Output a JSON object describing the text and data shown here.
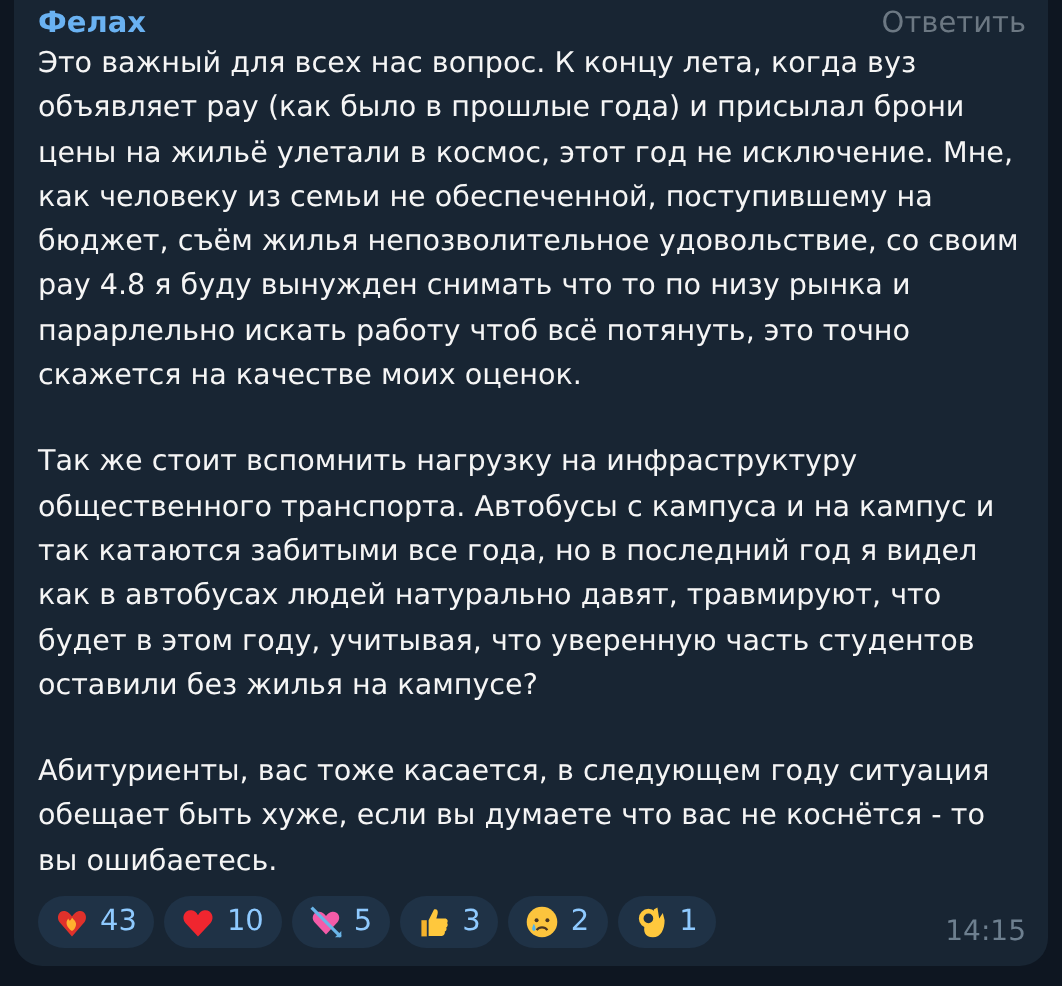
{
  "message": {
    "author": "Фелах",
    "reply_label": "Ответить",
    "paragraphs": [
      "Это важный для всех нас вопрос. К концу лета, когда вуз объявляет pay (как было в прошлые года) и присылал брони цены на жильё улетали в космос, этот год не исключение. Мне, как человеку из семьи не обеспеченной, поступившему на бюджет, съём жилья непозволительное удовольствие, со своим pay 4.8 я буду вынужден снимать что то по низу рынка и парарлельно искать работу чтоб всё потянуть, это точно скажется на качестве моих оценок.",
      "Так же стоит вспомнить нагрузку на инфраструктуру общественного транспорта. Автобусы с кампуса и на кампус и так катаются забитыми все года, но в последний год я видел как в автобусах людей натурально давят, травмируют, что будет в этом году, учитывая, что уверенную часть студентов оставили без жилья на кампусе?",
      "Абитуриенты, вас тоже касается, в следующем году ситуация обещает быть хуже, если вы думаете что вас не коснётся - то вы ошибаетесь."
    ],
    "reactions": [
      {
        "kind": "fire-heart",
        "count": "43"
      },
      {
        "kind": "heart",
        "count": "10"
      },
      {
        "kind": "heart-arrow",
        "count": "5"
      },
      {
        "kind": "thumbs-up",
        "count": "3"
      },
      {
        "kind": "crying-face",
        "count": "2"
      },
      {
        "kind": "ok-hand",
        "count": "1"
      }
    ],
    "time": "14:15"
  }
}
